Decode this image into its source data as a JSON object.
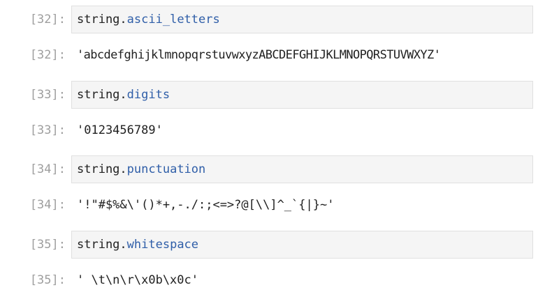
{
  "cells": [
    {
      "input_prompt": "[32]:",
      "code_object": "string",
      "code_dot": ".",
      "code_attr": "ascii_letters",
      "output_prompt": "[32]:",
      "output": "'abcdefghijklmnopqrstuvwxyzABCDEFGHIJKLMNOPQRSTUVWXYZ'"
    },
    {
      "input_prompt": "[33]:",
      "code_object": "string",
      "code_dot": ".",
      "code_attr": "digits",
      "output_prompt": "[33]:",
      "output": "'0123456789'"
    },
    {
      "input_prompt": "[34]:",
      "code_object": "string",
      "code_dot": ".",
      "code_attr": "punctuation",
      "output_prompt": "[34]:",
      "output": "'!\"#$%&\\'()*+,-./:;<=>?@[\\\\]^_`{|}~'"
    },
    {
      "input_prompt": "[35]:",
      "code_object": "string",
      "code_dot": ".",
      "code_attr": "whitespace",
      "output_prompt": "[35]:",
      "output": "' \\t\\n\\r\\x0b\\x0c'"
    }
  ],
  "colors": {
    "prompt": "#9e9e9e",
    "attribute": "#2f5ea8",
    "input_background": "#f5f5f5",
    "input_border": "#e0e0e0"
  }
}
